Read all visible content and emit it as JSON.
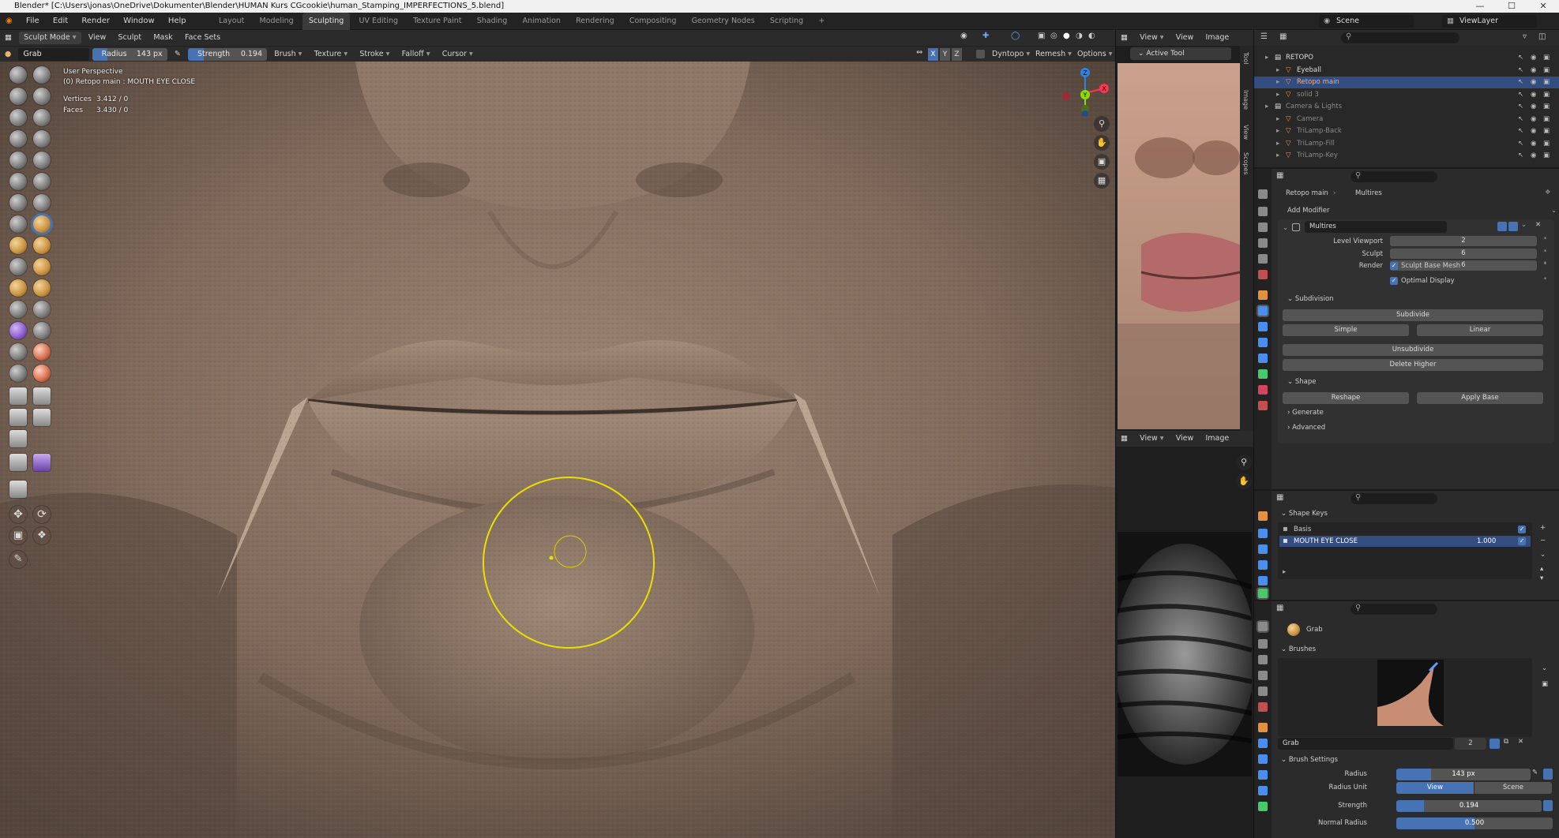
{
  "titlebar": {
    "text": "Blender* [C:\\Users\\jonas\\OneDrive\\Dokumenter\\Blender\\HUMAN Kurs CGcookie\\human_Stamping_IMPERFECTIONS_5.blend]",
    "min": "—",
    "max": "☐",
    "close": "✕"
  },
  "menu": [
    "File",
    "Edit",
    "Render",
    "Window",
    "Help"
  ],
  "workspaces": [
    "Layout",
    "Modeling",
    "Sculpting",
    "UV Editing",
    "Texture Paint",
    "Shading",
    "Animation",
    "Rendering",
    "Compositing",
    "Geometry Nodes",
    "Scripting"
  ],
  "workspace_add": "+",
  "scene": {
    "label": "Scene",
    "viewlayer": "ViewLayer"
  },
  "viewport_header": {
    "mode": "Sculpt Mode",
    "menus": [
      "View",
      "Sculpt",
      "Mask",
      "Face Sets"
    ],
    "right": [
      "Dyntopo",
      "Remesh",
      "Options"
    ],
    "axes": [
      "X",
      "Y",
      "Z"
    ]
  },
  "tool_header": {
    "brush": "Grab",
    "radius_label": "Radius",
    "radius_value": "143 px",
    "strength_label": "Strength",
    "strength_value": "0.194",
    "menus": [
      "Brush",
      "Texture",
      "Stroke",
      "Falloff",
      "Cursor"
    ]
  },
  "viewport": {
    "perspective": "User Perspective",
    "object": "(0) Retopo main : MOUTH EYE CLOSE",
    "vertices_label": "Vertices",
    "vertices": "3.412 / 0",
    "faces_label": "Faces",
    "faces": "3.430 / 0",
    "gizmo": {
      "x": "X",
      "y": "Y",
      "z": "Z"
    }
  },
  "image_editor": {
    "view": "View",
    "view2": "View",
    "image": "Image",
    "active_tool": "Active Tool",
    "side_tabs": [
      "Tool",
      "Image",
      "View",
      "Scopes"
    ]
  },
  "outliner": {
    "rows": [
      {
        "name": "RETOPO",
        "indent": 1,
        "type": "collection"
      },
      {
        "name": "Eyeball",
        "indent": 2,
        "type": "object"
      },
      {
        "name": "Retopo main",
        "indent": 2,
        "type": "object",
        "selected": true
      },
      {
        "name": "solid 3",
        "indent": 2,
        "type": "object",
        "dim": true
      },
      {
        "name": "Camera & Lights",
        "indent": 1,
        "type": "collection",
        "dim": true
      },
      {
        "name": "Camera",
        "indent": 2,
        "type": "object",
        "dim": true
      },
      {
        "name": "TriLamp-Back",
        "indent": 2,
        "type": "object",
        "dim": true
      },
      {
        "name": "TriLamp-Fill",
        "indent": 2,
        "type": "object",
        "dim": true
      },
      {
        "name": "TriLamp-Key",
        "indent": 2,
        "type": "object",
        "dim": true
      }
    ]
  },
  "properties": {
    "breadcrumb": [
      "Retopo main",
      "Multires"
    ],
    "add_modifier": "Add Modifier",
    "modifier_name": "Multires",
    "fields": [
      {
        "label": "Level Viewport",
        "value": "2"
      },
      {
        "label": "Sculpt",
        "value": "6"
      },
      {
        "label": "Render",
        "value": "6"
      }
    ],
    "checks": [
      "Sculpt Base Mesh",
      "Optimal Display"
    ],
    "subdivision": "Subdivision",
    "subdivide": "Subdivide",
    "simple": "Simple",
    "linear": "Linear",
    "unsubdivide": "Unsubdivide",
    "delete_higher": "Delete Higher",
    "shape": "Shape",
    "reshape": "Reshape",
    "apply_base": "Apply Base",
    "generate": "Generate",
    "advanced": "Advanced"
  },
  "shape_keys": {
    "title": "Shape Keys",
    "keys": [
      {
        "name": "Basis",
        "value": ""
      },
      {
        "name": "MOUTH EYE CLOSE",
        "value": "1.000"
      }
    ]
  },
  "tool_props": {
    "brush": "Grab",
    "brushes": "Brushes",
    "brush_name": "Grab",
    "brush_users": "2",
    "brush_settings": "Brush Settings",
    "radius_label": "Radius",
    "radius_value": "143 px",
    "radius_unit_label": "Radius Unit",
    "unit_view": "View",
    "unit_scene": "Scene",
    "strength_label": "Strength",
    "strength_value": "0.194",
    "normal_radius_label": "Normal Radius",
    "normal_radius_value": "0.500"
  },
  "colors": {
    "accent": "#4772b3",
    "selection": "#334d80",
    "cursor": "#e8e000"
  }
}
